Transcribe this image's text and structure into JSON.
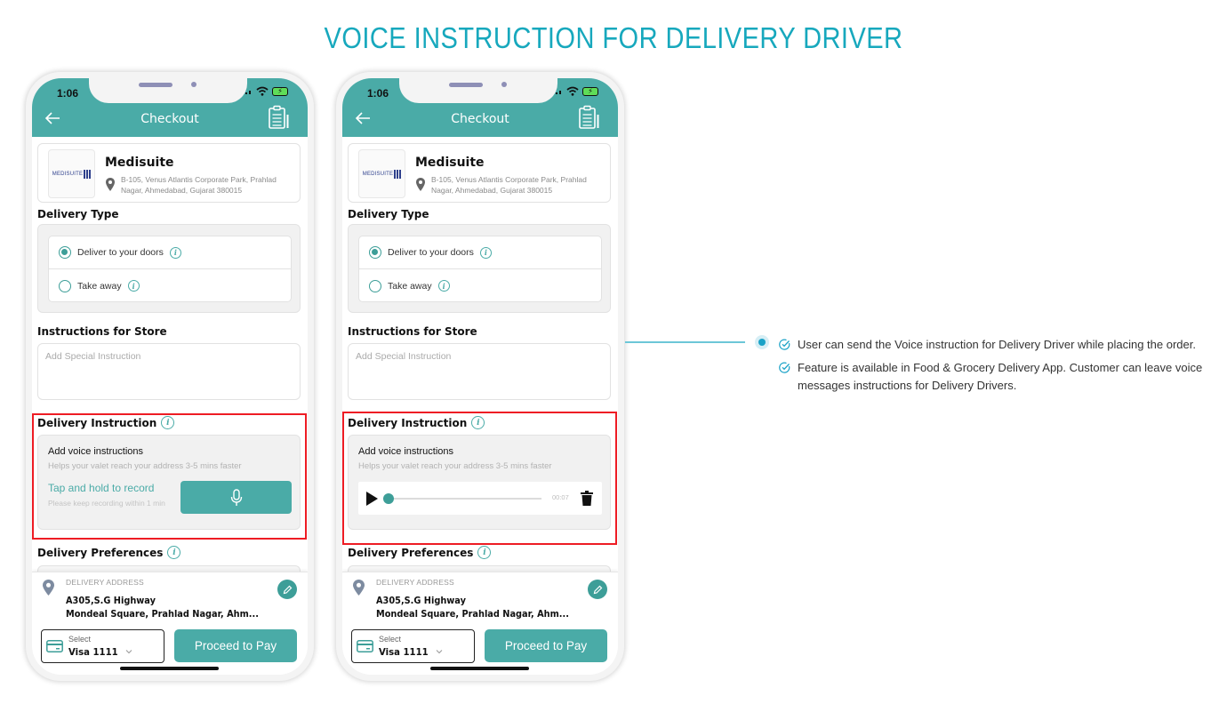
{
  "page": {
    "title": "VOICE INSTRUCTION FOR DELIVERY DRIVER"
  },
  "colors": {
    "title": "#17a8bd",
    "primary": "#4aaba7",
    "highlight": "#ee1c24",
    "connector": "#6cc7d8"
  },
  "phones": [
    {
      "status": {
        "time": "1:06"
      },
      "nav": {
        "title": "Checkout",
        "back_icon": "arrow-left-icon",
        "action_icon": "clipboard-icon"
      },
      "store": {
        "logo_text": "MEDISUITE",
        "name": "Medisuite",
        "address": "B-105, Venus Atlantis Corporate Park, Prahlad Nagar, Ahmedabad, Gujarat 380015"
      },
      "delivery_type": {
        "label": "Delivery Type",
        "options": [
          {
            "label": "Deliver to your doors",
            "selected": true
          },
          {
            "label": "Take away",
            "selected": false
          }
        ]
      },
      "store_instructions": {
        "label": "Instructions for Store",
        "placeholder": "Add Special Instruction",
        "value": ""
      },
      "delivery_instruction": {
        "label": "Delivery Instruction",
        "title": "Add voice instructions",
        "subtitle": "Helps your valet reach your address 3-5 mins faster",
        "record_label": "Tap and hold to record",
        "record_hint": "Please keep recording within 1 min"
      },
      "delivery_preferences": {
        "label": "Delivery Preferences"
      },
      "delivery_address": {
        "label": "DELIVERY ADDRESS",
        "line1": "A305,S.G Highway",
        "line2": "Mondeal Square, Prahlad Nagar, Ahm..."
      },
      "payment": {
        "select_label": "Select",
        "card": "Visa 1111",
        "button": "Proceed to Pay"
      }
    },
    {
      "status": {
        "time": "1:06"
      },
      "nav": {
        "title": "Checkout",
        "back_icon": "arrow-left-icon",
        "action_icon": "clipboard-icon"
      },
      "store": {
        "logo_text": "MEDISUITE",
        "name": "Medisuite",
        "address": "B-105, Venus Atlantis Corporate Park, Prahlad Nagar, Ahmedabad, Gujarat 380015"
      },
      "delivery_type": {
        "label": "Delivery Type",
        "options": [
          {
            "label": "Deliver to your doors",
            "selected": true
          },
          {
            "label": "Take away",
            "selected": false
          }
        ]
      },
      "store_instructions": {
        "label": "Instructions for Store",
        "placeholder": "Add Special Instruction",
        "value": ""
      },
      "delivery_instruction": {
        "label": "Delivery Instruction",
        "title": "Add voice instructions",
        "subtitle": "Helps your valet reach your address 3-5 mins faster",
        "player": {
          "duration": "00:07",
          "progress": 0
        }
      },
      "delivery_preferences": {
        "label": "Delivery Preferences"
      },
      "delivery_address": {
        "label": "DELIVERY ADDRESS",
        "line1": "A305,S.G Highway",
        "line2": "Mondeal Square, Prahlad Nagar, Ahm..."
      },
      "payment": {
        "select_label": "Select",
        "card": "Visa 1111",
        "button": "Proceed to Pay"
      }
    }
  ],
  "features": [
    "User can send the Voice instruction for Delivery Driver while placing the order.",
    "Feature is available in Food & Grocery Delivery App. Customer can leave voice messages instructions for Delivery Drivers."
  ]
}
